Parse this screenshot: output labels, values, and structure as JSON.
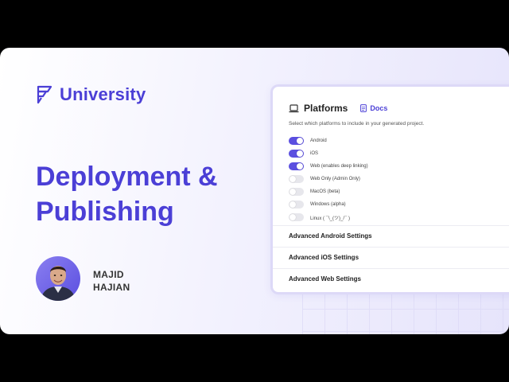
{
  "brand": {
    "name": "University",
    "color": "#4b3fd6"
  },
  "title": {
    "line1": "Deployment &",
    "line2": "Publishing"
  },
  "author": {
    "first": "MAJID",
    "last": "HAJIAN"
  },
  "panel": {
    "title": "Platforms",
    "docs_label": "Docs",
    "description": "Select which platforms to include in your generated project.",
    "platforms": [
      {
        "label": "Android",
        "enabled": true
      },
      {
        "label": "iOS",
        "enabled": true
      },
      {
        "label": "Web (enables deep linking)",
        "enabled": true
      },
      {
        "label": "Web Only (Admin Only)",
        "enabled": false
      },
      {
        "label": "MacOS (beta)",
        "enabled": false
      },
      {
        "label": "Windows (alpha)",
        "enabled": false
      },
      {
        "label": "Linux ( ¯\\_(ツ)_/¯ )",
        "enabled": false
      }
    ],
    "advanced": [
      {
        "label": "Advanced Android Settings"
      },
      {
        "label": "Advanced iOS Settings"
      },
      {
        "label": "Advanced Web Settings"
      }
    ]
  },
  "colors": {
    "accent": "#5b4fe0",
    "toggle_off": "#e7e7ec"
  }
}
